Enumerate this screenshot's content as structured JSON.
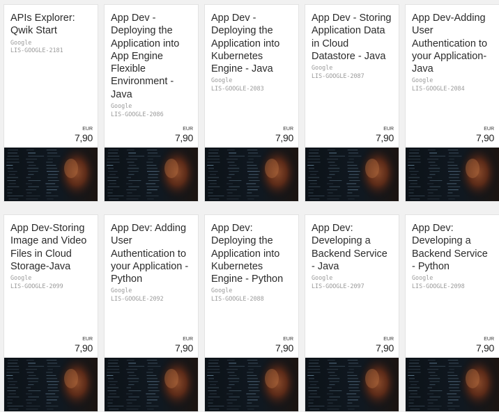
{
  "products": [
    {
      "title": "APIs Explorer: Qwik Start",
      "vendor": "Google",
      "sku": "LIS-GOOGLE-2181",
      "currency": "EUR",
      "price": "7,90"
    },
    {
      "title": "App Dev - Deploying the Application into App Engine Flexible Environment - Java",
      "vendor": "Google",
      "sku": "LIS-GOOGLE-2086",
      "currency": "EUR",
      "price": "7,90"
    },
    {
      "title": "App Dev - Deploying the Application into Kubernetes Engine - Java",
      "vendor": "Google",
      "sku": "LIS-GOOGLE-2083",
      "currency": "EUR",
      "price": "7,90"
    },
    {
      "title": "App Dev - Storing Application Data in Cloud Datastore - Java",
      "vendor": "Google",
      "sku": "LIS-GOOGLE-2087",
      "currency": "EUR",
      "price": "7,90"
    },
    {
      "title": "App Dev-Adding User Authentication to your Application-Java",
      "vendor": "Google",
      "sku": "LIS-GOOGLE-2084",
      "currency": "EUR",
      "price": "7,90"
    },
    {
      "title": "App Dev-Storing Image and Video Files in Cloud Storage-Java",
      "vendor": "Google",
      "sku": "LIS-GOOGLE-2099",
      "currency": "EUR",
      "price": "7,90"
    },
    {
      "title": "App Dev: Adding User Authentication to your Application - Python",
      "vendor": "Google",
      "sku": "LIS-GOOGLE-2092",
      "currency": "EUR",
      "price": "7,90"
    },
    {
      "title": "App Dev: Deploying the Application into Kubernetes Engine - Python",
      "vendor": "Google",
      "sku": "LIS-GOOGLE-2088",
      "currency": "EUR",
      "price": "7,90"
    },
    {
      "title": "App Dev: Developing a Backend Service - Java",
      "vendor": "Google",
      "sku": "LIS-GOOGLE-2097",
      "currency": "EUR",
      "price": "7,90"
    },
    {
      "title": "App Dev: Developing a Backend Service - Python",
      "vendor": "Google",
      "sku": "LIS-GOOGLE-2098",
      "currency": "EUR",
      "price": "7,90"
    }
  ],
  "theme": {
    "page_background": "#f1f1f1",
    "card_background": "#ffffff",
    "title_color": "#2b2b2b",
    "meta_color": "#9a9a9a"
  }
}
